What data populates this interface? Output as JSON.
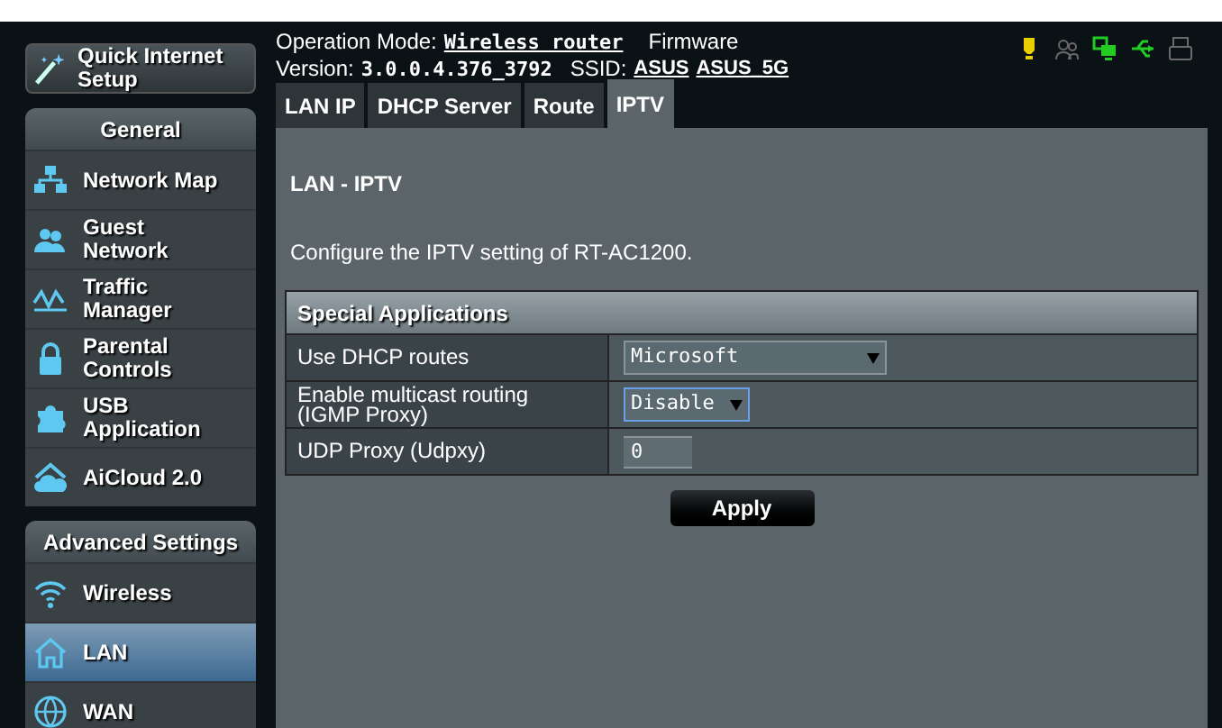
{
  "quick_setup": {
    "label": "Quick Internet Setup"
  },
  "header": {
    "operation_mode_label": "Operation Mode:",
    "operation_mode": "Wireless router",
    "firmware_label": "Firmware",
    "version_label": "Version:",
    "version": "3.0.0.4.376_3792",
    "ssid_label": "SSID:",
    "ssids": [
      "ASUS",
      "ASUS_5G"
    ]
  },
  "status_icons": [
    {
      "kind": "tip",
      "color": "#e8d000"
    },
    {
      "kind": "clients",
      "color": "#6a6a6a"
    },
    {
      "kind": "network",
      "color": "#22cc22"
    },
    {
      "kind": "usb",
      "color": "#22cc22"
    },
    {
      "kind": "printer",
      "color": "#6a6a6a"
    }
  ],
  "sidebar": [
    {
      "title": "General",
      "items": [
        {
          "label": "Network Map",
          "kind": "network",
          "selected": false
        },
        {
          "label": "Guest Network",
          "kind": "guest",
          "selected": false
        },
        {
          "label": "Traffic Manager",
          "kind": "traffic",
          "selected": false
        },
        {
          "label": "Parental Controls",
          "kind": "lock",
          "selected": false
        },
        {
          "label": "USB Application",
          "kind": "puzzle",
          "selected": false
        },
        {
          "label": "AiCloud 2.0",
          "kind": "cloud",
          "selected": false
        }
      ]
    },
    {
      "title": "Advanced Settings",
      "items": [
        {
          "label": "Wireless",
          "kind": "wifi",
          "selected": false
        },
        {
          "label": "LAN",
          "kind": "home",
          "selected": true
        },
        {
          "label": "WAN",
          "kind": "globe",
          "selected": false
        }
      ]
    }
  ],
  "tabs": [
    {
      "label": "LAN IP",
      "selected": false
    },
    {
      "label": "DHCP Server",
      "selected": false
    },
    {
      "label": "Route",
      "selected": false
    },
    {
      "label": "IPTV",
      "selected": true
    }
  ],
  "page": {
    "title": "LAN - IPTV",
    "description": "Configure the IPTV setting of RT-AC1200.",
    "table": {
      "title": "Special Applications",
      "rows": [
        {
          "label": "Use DHCP routes",
          "kind": "select",
          "value": "Microsoft",
          "focused": false
        },
        {
          "label": "Enable multicast routing (IGMP Proxy)",
          "kind": "select",
          "value": "Disable",
          "focused": true
        },
        {
          "label": "UDP Proxy (Udpxy)",
          "kind": "input",
          "value": "0",
          "focused": false
        }
      ]
    },
    "apply": "Apply"
  }
}
